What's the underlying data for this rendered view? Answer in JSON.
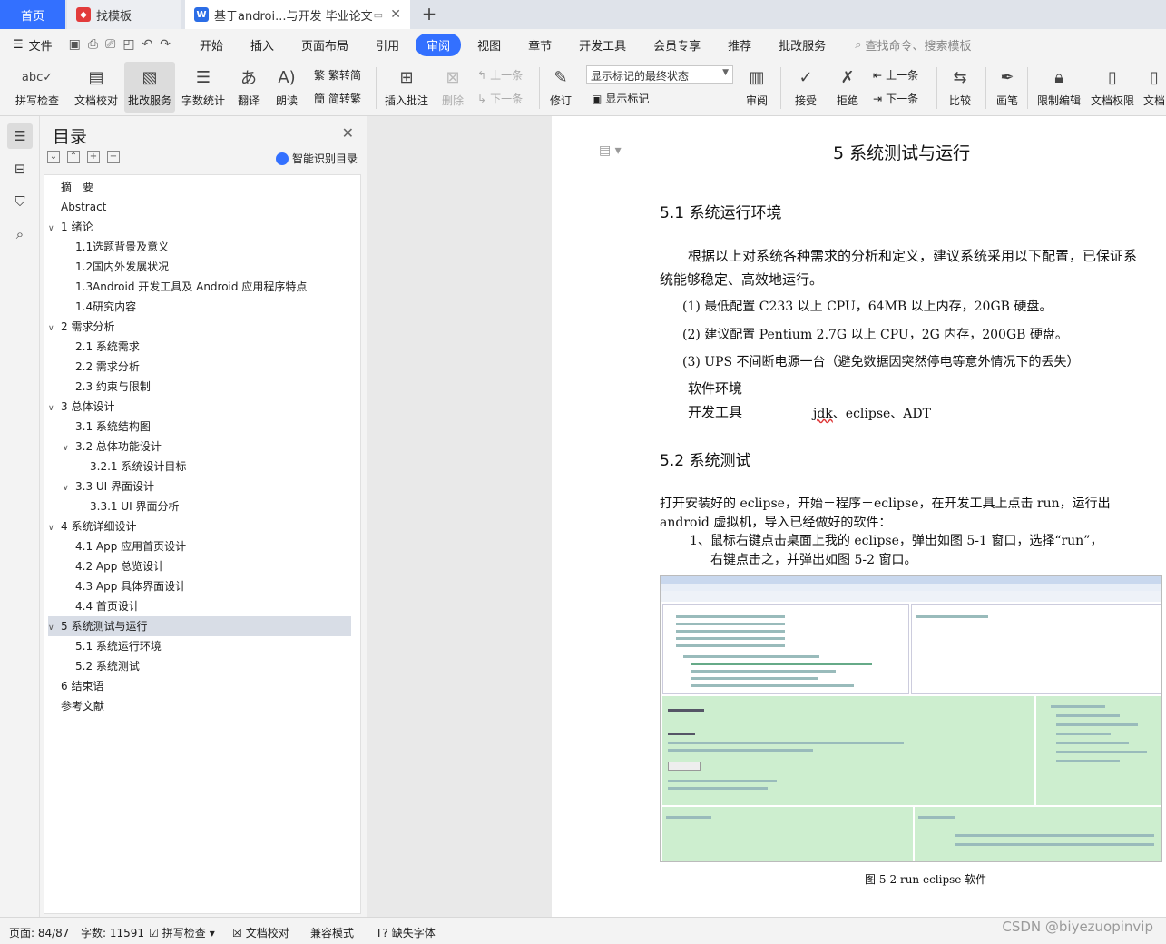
{
  "tabs": {
    "home": "首页",
    "template": "找模板",
    "document": "基于androi...与开发 毕业论文"
  },
  "menubar": {
    "file": "文件",
    "items": [
      "开始",
      "插入",
      "页面布局",
      "引用",
      "审阅",
      "视图",
      "章节",
      "开发工具",
      "会员专享",
      "推荐",
      "批改服务"
    ],
    "active": "审阅",
    "search": "查找命令、搜索模板"
  },
  "ribbon": {
    "spellcheck": "拼写检查",
    "doccheck": "文档校对",
    "correction": "批改服务",
    "wordcount": "字数统计",
    "translate": "翻译",
    "read": "朗读",
    "trad": "繁转简",
    "simp": "简转繁",
    "insert_comment": "插入批注",
    "delete": "删除",
    "prev": "上一条",
    "next": "下一条",
    "track": "修订",
    "markup_select": "显示标记的最终状态",
    "show_markup": "显示标记",
    "review": "审阅",
    "accept": "接受",
    "reject": "拒绝",
    "prev2": "上一条",
    "next2": "下一条",
    "compare": "比较",
    "pen": "画笔",
    "restrict": "限制编辑",
    "perm": "文档权限",
    "doc_more": "文档"
  },
  "toc": {
    "title": "目录",
    "smart": "智能识别目录",
    "items": [
      {
        "label": "摘　要",
        "level": 0,
        "chev": ""
      },
      {
        "label": "Abstract",
        "level": 0,
        "chev": ""
      },
      {
        "label": "1  绪论",
        "level": 0,
        "chev": "v"
      },
      {
        "label": "1.1选题背景及意义",
        "level": 1,
        "chev": ""
      },
      {
        "label": "1.2国内外发展状况",
        "level": 1,
        "chev": ""
      },
      {
        "label": "1.3Android 开发工具及 Android 应用程序特点",
        "level": 1,
        "chev": ""
      },
      {
        "label": "1.4研究内容",
        "level": 1,
        "chev": ""
      },
      {
        "label": "2  需求分析",
        "level": 0,
        "chev": "v"
      },
      {
        "label": "2.1  系统需求",
        "level": 1,
        "chev": ""
      },
      {
        "label": "2.2  需求分析",
        "level": 1,
        "chev": ""
      },
      {
        "label": "2.3  约束与限制",
        "level": 1,
        "chev": ""
      },
      {
        "label": "3  总体设计",
        "level": 0,
        "chev": "v"
      },
      {
        "label": "3.1  系统结构图",
        "level": 1,
        "chev": ""
      },
      {
        "label": "3.2  总体功能设计",
        "level": 1,
        "chev": "v"
      },
      {
        "label": "3.2.1  系统设计目标",
        "level": 2,
        "chev": ""
      },
      {
        "label": "3.3 UI 界面设计",
        "level": 1,
        "chev": "v"
      },
      {
        "label": "3.3.1 UI 界面分析",
        "level": 2,
        "chev": ""
      },
      {
        "label": "4  系统详细设计",
        "level": 0,
        "chev": "v"
      },
      {
        "label": "4.1 App 应用首页设计",
        "level": 1,
        "chev": ""
      },
      {
        "label": "4.2 App 总览设计",
        "level": 1,
        "chev": ""
      },
      {
        "label": "4.3 App 具体界面设计",
        "level": 1,
        "chev": ""
      },
      {
        "label": "4.4  首页设计",
        "level": 1,
        "chev": ""
      },
      {
        "label": "5  系统测试与运行",
        "level": 0,
        "chev": "v",
        "selected": true
      },
      {
        "label": "5.1  系统运行环境",
        "level": 1,
        "chev": ""
      },
      {
        "label": "5.2  系统测试",
        "level": 1,
        "chev": ""
      },
      {
        "label": "6  结束语",
        "level": 0,
        "chev": ""
      },
      {
        "label": "参考文献",
        "level": 0,
        "chev": ""
      }
    ]
  },
  "document": {
    "heading": "5  系统测试与运行",
    "s51": "5.1  系统运行环境",
    "p1a": "根据以上对系统各种需求的分析和定义，建议系统采用以下配置，已保证系",
    "p1b": "统能够稳定、高效地运行。",
    "c1": "(1) 最低配置    C233 以上 CPU，64MB 以上内存，20GB 硬盘。",
    "c2": "(2) 建议配置    Pentium 2.7G 以上 CPU，2G 内存，200GB 硬盘。",
    "c3": "(3) UPS 不间断电源一台（避免数据因突然停电等意外情况下的丢失）",
    "sw": "软件环境",
    "dev_label": "开发工具",
    "dev_tool_jdk": "jdk",
    "dev_tools_rest": "、eclipse、ADT",
    "s52": "5.2  系统测试",
    "p2a": "打开安装好的 eclipse，开始－程序－eclipse，在开发工具上点击 run，运行出",
    "p2b": "android 虚拟机，导入已经做好的软件：",
    "p3a": "1、鼠标右键点击桌面上我的 eclipse，弹出如图 5-1 窗口，选择“run”，",
    "p3b": "右键点击之，并弹出如图 5-2 窗口。",
    "caption": "图 5-2 run eclipse 软件"
  },
  "statusbar": {
    "page": "页面: 84/87",
    "words": "字数: 11591",
    "spell": "拼写检查",
    "doccheck": "文档校对",
    "compat": "兼容模式",
    "missing_font": "缺失字体"
  },
  "watermark": "CSDN @biyezuopinvip",
  "colors": {
    "accent": "#3370ff",
    "toc_selected": "#d8dde6"
  }
}
